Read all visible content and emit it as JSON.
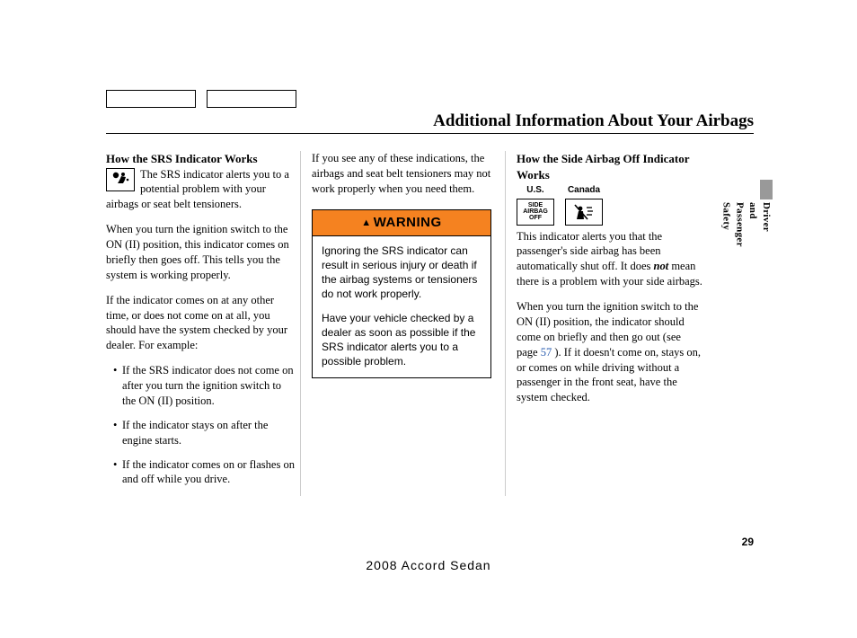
{
  "title": "Additional Information About Your Airbags",
  "page_number": "29",
  "footer": "2008  Accord  Sedan",
  "side_section": "Driver and Passenger Safety",
  "col1": {
    "heading": "How the SRS Indicator Works",
    "p1": "The SRS indicator alerts you to a potential problem with your airbags or seat belt tensioners.",
    "p2": "When you turn the ignition switch to the ON (II) position, this indicator comes on briefly then goes off. This tells you the system is working properly.",
    "p3": "If the indicator comes on at any other time, or does not come on at all, you should have the system checked by your dealer. For example:",
    "bullets": [
      "If the SRS indicator does not come on after you turn the ignition switch to the ON (II) position.",
      "If the indicator stays on after the engine starts.",
      "If the indicator comes on or flashes on and off while you drive."
    ]
  },
  "col2": {
    "p1": "If you see any of these indications, the airbags and seat belt tensioners may not work properly when you need them.",
    "warning_label": "WARNING",
    "warning_p1": "Ignoring the SRS indicator can result in serious injury or death if the airbag systems or tensioners do not work properly.",
    "warning_p2": "Have your vehicle checked by a dealer as soon as possible if the SRS indicator alerts you to a possible problem."
  },
  "col3": {
    "heading": "How the Side Airbag Off Indicator Works",
    "us_label": "U.S.",
    "canada_label": "Canada",
    "us_icon_text": "SIDE\nAIRBAG\nOFF",
    "p1a": "This indicator alerts you that the passenger's side airbag has been automatically shut off. It does ",
    "p1_not": "not",
    "p1b": " mean there is a problem with your side airbags.",
    "p2a": "When you turn the ignition switch to the ON (II) position, the indicator should come on briefly and then go out (see page ",
    "p2_ref": "57",
    "p2b": " ). If it doesn't come on, stays on, or comes on while driving without a passenger in the front seat, have the system checked."
  }
}
